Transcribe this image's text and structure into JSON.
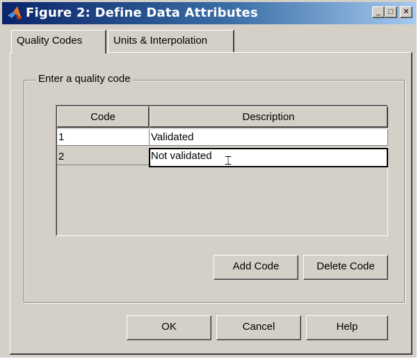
{
  "window": {
    "title": "Figure 2: Define Data Attributes",
    "icon": "matlab-logo-icon",
    "controls": {
      "minimize": "_",
      "maximize": "□",
      "close": "✕"
    }
  },
  "tabs": [
    {
      "label": "Quality Codes",
      "active": true
    },
    {
      "label": "Units & Interpolation",
      "active": false
    }
  ],
  "group": {
    "label": "Enter a quality code",
    "table": {
      "columns": [
        "Code",
        "Description"
      ],
      "rows": [
        {
          "code": "1",
          "description": "Validated"
        },
        {
          "code": "2",
          "description": "Not validated"
        }
      ],
      "editing_row": 2
    },
    "buttons": {
      "add": "Add Code",
      "delete": "Delete Code"
    }
  },
  "dialog_buttons": {
    "ok": "OK",
    "cancel": "Cancel",
    "help": "Help"
  },
  "colors": {
    "face": "#d4d0c8",
    "title_start": "#0a246a",
    "title_end": "#a6caf0"
  }
}
